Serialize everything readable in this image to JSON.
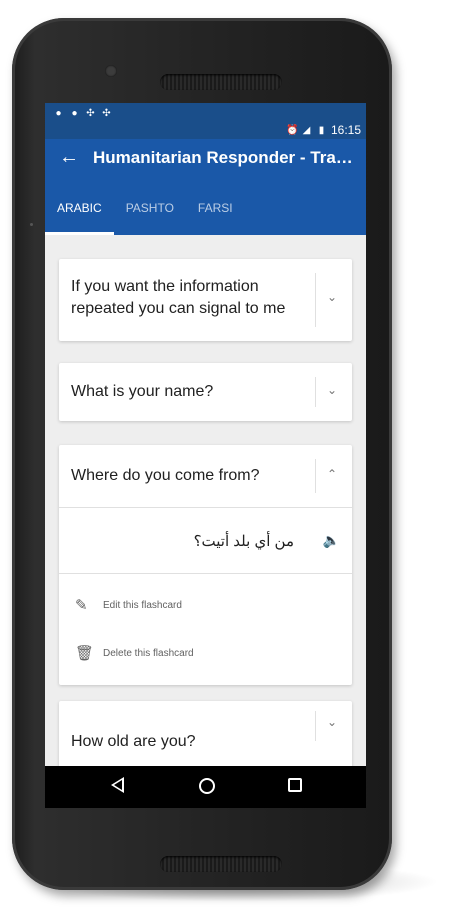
{
  "status_bar": {
    "time": "16:15",
    "left_icons": [
      "location-icon",
      "chat-icon",
      "usb-icon",
      "usb-icon"
    ],
    "right_icons": [
      "alarm-icon",
      "lte-signal-icon",
      "battery-icon"
    ]
  },
  "app_bar": {
    "back_icon": "←",
    "title": "Humanitarian Responder - Transit..."
  },
  "tabs": [
    {
      "label": "ARABIC",
      "active": true
    },
    {
      "label": "PASHTO",
      "active": false
    },
    {
      "label": "FARSI",
      "active": false
    }
  ],
  "cards": [
    {
      "question_line1": "If you want the information",
      "question_line2": "repeated you can signal to me",
      "expanded": false
    },
    {
      "question": "What is your name?",
      "expanded": false
    },
    {
      "question": "Where do you come from?",
      "expanded": true,
      "translation": "من أي بلد أتيت؟",
      "actions": {
        "edit": "Edit this flashcard",
        "delete": "Delete this flashcard"
      }
    },
    {
      "question": "How old are you?",
      "expanded": false
    }
  ],
  "glyphs": {
    "chevron_down": "⌄",
    "chevron_up": "⌃",
    "speaker": "🔈",
    "edit": "✎",
    "delete": "🗑"
  },
  "colors": {
    "status_bar": "#1a4e8a",
    "app_bar": "#1a58a8",
    "background": "#eeeeee"
  }
}
